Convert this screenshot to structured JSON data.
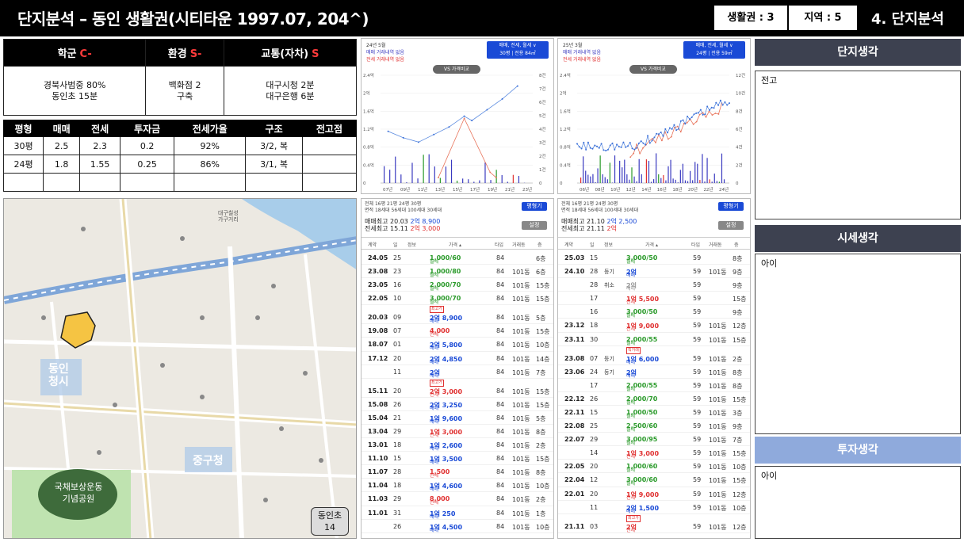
{
  "header": {
    "title": "단지분석 – 동인 생활권(시티타운 1997.07, 204^)",
    "box1": "생활권 : 3",
    "box2": "지역 : 5",
    "section": "4. 단지분석"
  },
  "grades": {
    "cols": [
      {
        "label": "학군",
        "grade": "C-",
        "lines": [
          "경북사범중 80%",
          "동인초 15분"
        ]
      },
      {
        "label": "환경",
        "grade": "S-",
        "lines": [
          "백화점 2",
          "구축"
        ]
      },
      {
        "label": "교통(자차)",
        "grade": "S",
        "lines": [
          "대구시청 2분",
          "대구은행 6분"
        ]
      }
    ]
  },
  "pyeong_table": {
    "headers": [
      "평형",
      "매매",
      "전세",
      "투자금",
      "전세가율",
      "구조",
      "전고점"
    ],
    "rows": [
      [
        "30평",
        "2.5",
        "2.3",
        "0.2",
        "92%",
        "3/2, 복",
        ""
      ],
      [
        "24평",
        "1.8",
        "1.55",
        "0.25",
        "86%",
        "3/1, 복",
        ""
      ],
      [
        "",
        "",
        "",
        "",
        "",
        "",
        ""
      ]
    ]
  },
  "map": {
    "labels": {
      "dongin": "동인\n청시",
      "junggu": "중구청",
      "park": "국채보상운동\n기념공원",
      "school": "동인초\n14",
      "daegu_gagu": "대구칠성\n가구거리"
    }
  },
  "chart1": {
    "date": "24년 5월",
    "note1": "매매 거래내역 없음",
    "note2": "전세 거래내역 없음",
    "sel1": "매매, 전세, 월세 ∨",
    "sel2": "30평 | 전용 84㎡",
    "vs": "VS 가격비교",
    "y_left": [
      "2.4억",
      "2억",
      "1.6억",
      "1.2억",
      "0.8억",
      "0.4억",
      "0"
    ],
    "y_right": [
      "8건",
      "7건",
      "6건",
      "5건",
      "4건",
      "3건",
      "2건",
      "1건",
      "0"
    ],
    "x": [
      "07년",
      "09년",
      "11년",
      "13년",
      "15년",
      "17년",
      "19년",
      "21년",
      "23년"
    ]
  },
  "chart2": {
    "date": "25년 3월",
    "note1": "매매 거래내역 없음",
    "note2": "전세 거래내역 없음",
    "sel1": "매매, 전세, 월세 ∨",
    "sel2": "24평 | 전용 59㎡",
    "vs": "VS 가격비교",
    "y_left": [
      "2.4억",
      "2억",
      "1.6억",
      "1.2억",
      "0.8억",
      "0.4억",
      "0"
    ],
    "y_right": [
      "12건",
      "10건",
      "8건",
      "6건",
      "4건",
      "2건",
      "0"
    ],
    "x": [
      "06년",
      "08년",
      "10년",
      "12년",
      "14년",
      "16년",
      "18년",
      "20년",
      "22년",
      "24년"
    ]
  },
  "tx1": {
    "tabs": "전체  16평  21평  24평  30평",
    "tabs2": "면적  18세대  56세대  100세대  30세대",
    "btn1": "평형기",
    "btn2": "설정",
    "sum1a": "매매최고 20.03",
    "sum1b": "2억 8,900",
    "sum2a": "전세최고 15.11",
    "sum2b": "2억 3,000",
    "cols": [
      "계약",
      "일",
      "정보",
      "가격 ▴",
      "타입",
      "거래동",
      "층"
    ],
    "rows": [
      {
        "d": "24.05",
        "dy": "25",
        "ty": "",
        "k": "월세",
        "p": "1,000/60",
        "c": "gr",
        "ar": "84",
        "dg": "",
        "fl": "6층"
      },
      {
        "d": "23.08",
        "dy": "23",
        "ty": "",
        "k": "월세",
        "p": "1,000/80",
        "c": "gr",
        "ar": "84",
        "dg": "101동",
        "fl": "6층"
      },
      {
        "d": "23.05",
        "dy": "16",
        "ty": "",
        "k": "월세",
        "p": "2,000/70",
        "c": "gr",
        "ar": "84",
        "dg": "101동",
        "fl": "15층"
      },
      {
        "d": "22.05",
        "dy": "10",
        "ty": "",
        "k": "월세",
        "p": "3,000/70",
        "c": "gr",
        "ar": "84",
        "dg": "101동",
        "fl": "15층"
      },
      {
        "d": "20.03",
        "dy": "09",
        "ty": "",
        "k": "매매",
        "p": "2억 8,900",
        "c": "bl",
        "ar": "84",
        "dg": "101동",
        "fl": "5층",
        "badge": "최고가",
        "tall": true
      },
      {
        "d": "19.08",
        "dy": "07",
        "ty": "",
        "k": "전세",
        "p": "4,000",
        "c": "rd",
        "ar": "84",
        "dg": "101동",
        "fl": "15층"
      },
      {
        "d": "18.07",
        "dy": "01",
        "ty": "",
        "k": "매매",
        "p": "2억 5,800",
        "c": "bl",
        "ar": "84",
        "dg": "101동",
        "fl": "10층"
      },
      {
        "d": "17.12",
        "dy": "20",
        "ty": "",
        "k": "매매",
        "p": "2억 4,850",
        "c": "bl",
        "ar": "84",
        "dg": "101동",
        "fl": "14층"
      },
      {
        "d": "",
        "dy": "11",
        "ty": "",
        "k": "매매",
        "p": "2억",
        "c": "bl",
        "ar": "84",
        "dg": "101동",
        "fl": "7층"
      },
      {
        "d": "15.11",
        "dy": "20",
        "ty": "",
        "k": "전세",
        "p": "2억 3,000",
        "c": "rd",
        "ar": "84",
        "dg": "101동",
        "fl": "15층",
        "badge": "최고가",
        "tall": true
      },
      {
        "d": "15.08",
        "dy": "26",
        "ty": "",
        "k": "매매",
        "p": "2억 3,250",
        "c": "bl",
        "ar": "84",
        "dg": "101동",
        "fl": "15층"
      },
      {
        "d": "15.04",
        "dy": "21",
        "ty": "",
        "k": "매매",
        "p": "1억 9,600",
        "c": "bl",
        "ar": "84",
        "dg": "101동",
        "fl": "5층"
      },
      {
        "d": "13.04",
        "dy": "29",
        "ty": "",
        "k": "전세",
        "p": "1억 3,000",
        "c": "rd",
        "ar": "84",
        "dg": "101동",
        "fl": "8층"
      },
      {
        "d": "13.01",
        "dy": "18",
        "ty": "",
        "k": "매매",
        "p": "1억 2,600",
        "c": "bl",
        "ar": "84",
        "dg": "101동",
        "fl": "2층"
      },
      {
        "d": "11.10",
        "dy": "15",
        "ty": "",
        "k": "매매",
        "p": "1억 3,500",
        "c": "bl",
        "ar": "84",
        "dg": "101동",
        "fl": "15층"
      },
      {
        "d": "11.07",
        "dy": "28",
        "ty": "",
        "k": "전세",
        "p": "1,500",
        "c": "rd",
        "ar": "84",
        "dg": "101동",
        "fl": "8층"
      },
      {
        "d": "11.04",
        "dy": "18",
        "ty": "",
        "k": "매매",
        "p": "1억 4,600",
        "c": "bl",
        "ar": "84",
        "dg": "101동",
        "fl": "10층"
      },
      {
        "d": "11.03",
        "dy": "29",
        "ty": "",
        "k": "전세",
        "p": "8,000",
        "c": "rd",
        "ar": "84",
        "dg": "101동",
        "fl": "2층"
      },
      {
        "d": "11.01",
        "dy": "31",
        "ty": "",
        "k": "매매",
        "p": "1억 250",
        "c": "bl",
        "ar": "84",
        "dg": "101동",
        "fl": "1층"
      },
      {
        "d": "",
        "dy": "26",
        "ty": "",
        "k": "매매",
        "p": "1억 4,500",
        "c": "bl",
        "ar": "84",
        "dg": "101동",
        "fl": "10층"
      }
    ]
  },
  "tx2": {
    "tabs": "전체  16평  21평  24평  30평",
    "tabs2": "면적  18세대  56세대  100세대  30세대",
    "btn1": "평형기",
    "btn2": "설정",
    "sum1a": "매매최고 21.10",
    "sum1b": "2억 2,500",
    "sum2a": "전세최고 21.11",
    "sum2b": "2억",
    "cols": [
      "계약",
      "일",
      "정보",
      "가격 ▴",
      "타입",
      "거래동",
      "층"
    ],
    "rows": [
      {
        "d": "25.03",
        "dy": "15",
        "ty": "",
        "k": "월세",
        "p": "3,000/50",
        "c": "gr",
        "ar": "59",
        "dg": "",
        "fl": "8층"
      },
      {
        "d": "24.10",
        "dy": "28",
        "ty": "등기",
        "k": "매매",
        "p": "2억",
        "c": "bl",
        "ar": "59",
        "dg": "101동",
        "fl": "9층"
      },
      {
        "d": "",
        "dy": "28",
        "ty": "취소",
        "k": "매매",
        "p": "2억",
        "c": "gy",
        "ar": "59",
        "dg": "",
        "fl": "9층"
      },
      {
        "d": "",
        "dy": "17",
        "ty": "",
        "k": "전세",
        "p": "1억 5,500",
        "c": "rd",
        "ar": "59",
        "dg": "",
        "fl": "15층"
      },
      {
        "d": "",
        "dy": "16",
        "ty": "",
        "k": "월세",
        "p": "3,000/50",
        "c": "gr",
        "ar": "59",
        "dg": "",
        "fl": "9층"
      },
      {
        "d": "23.12",
        "dy": "18",
        "ty": "",
        "k": "전세",
        "p": "1억 9,000",
        "c": "rd",
        "ar": "59",
        "dg": "101동",
        "fl": "12층"
      },
      {
        "d": "23.11",
        "dy": "30",
        "ty": "",
        "k": "월세",
        "p": "2,000/55",
        "c": "gr",
        "ar": "59",
        "dg": "101동",
        "fl": "15층"
      },
      {
        "d": "23.08",
        "dy": "07",
        "ty": "등기",
        "k": "매매",
        "p": "1억 6,000",
        "c": "bl",
        "ar": "59",
        "dg": "101동",
        "fl": "2층",
        "badge": "직거래",
        "tall": true
      },
      {
        "d": "23.06",
        "dy": "24",
        "ty": "등기",
        "k": "매매",
        "p": "2억",
        "c": "bl",
        "ar": "59",
        "dg": "101동",
        "fl": "8층"
      },
      {
        "d": "",
        "dy": "17",
        "ty": "",
        "k": "월세",
        "p": "2,000/55",
        "c": "gr",
        "ar": "59",
        "dg": "101동",
        "fl": "8층"
      },
      {
        "d": "22.12",
        "dy": "26",
        "ty": "",
        "k": "월세",
        "p": "2,000/70",
        "c": "gr",
        "ar": "59",
        "dg": "101동",
        "fl": "15층"
      },
      {
        "d": "22.11",
        "dy": "15",
        "ty": "",
        "k": "월세",
        "p": "1,000/50",
        "c": "gr",
        "ar": "59",
        "dg": "101동",
        "fl": "3층"
      },
      {
        "d": "22.08",
        "dy": "25",
        "ty": "",
        "k": "월세",
        "p": "2,500/60",
        "c": "gr",
        "ar": "59",
        "dg": "101동",
        "fl": "9층"
      },
      {
        "d": "22.07",
        "dy": "29",
        "ty": "",
        "k": "월세",
        "p": "3,000/95",
        "c": "gr",
        "ar": "59",
        "dg": "101동",
        "fl": "7층"
      },
      {
        "d": "",
        "dy": "14",
        "ty": "",
        "k": "전세",
        "p": "1억 3,000",
        "c": "rd",
        "ar": "59",
        "dg": "101동",
        "fl": "15층"
      },
      {
        "d": "22.05",
        "dy": "20",
        "ty": "",
        "k": "월세",
        "p": "1,000/60",
        "c": "gr",
        "ar": "59",
        "dg": "101동",
        "fl": "10층"
      },
      {
        "d": "22.04",
        "dy": "12",
        "ty": "",
        "k": "월세",
        "p": "3,000/60",
        "c": "gr",
        "ar": "59",
        "dg": "101동",
        "fl": "15층"
      },
      {
        "d": "22.01",
        "dy": "20",
        "ty": "",
        "k": "전세",
        "p": "1억 9,000",
        "c": "rd",
        "ar": "59",
        "dg": "101동",
        "fl": "12층"
      },
      {
        "d": "",
        "dy": "11",
        "ty": "",
        "k": "매매",
        "p": "2억 1,500",
        "c": "bl",
        "ar": "59",
        "dg": "101동",
        "fl": "10층"
      },
      {
        "d": "21.11",
        "dy": "03",
        "ty": "",
        "k": "전세",
        "p": "2억",
        "c": "rd",
        "ar": "59",
        "dg": "101동",
        "fl": "12층",
        "badge": "최고가",
        "tall": true
      }
    ]
  },
  "side": {
    "s1_title": "단지생각",
    "s1_text": "전고",
    "s2_title": "시세생각",
    "s2_text": "아이",
    "s3_title": "투자생각",
    "s3_text": "아이"
  }
}
